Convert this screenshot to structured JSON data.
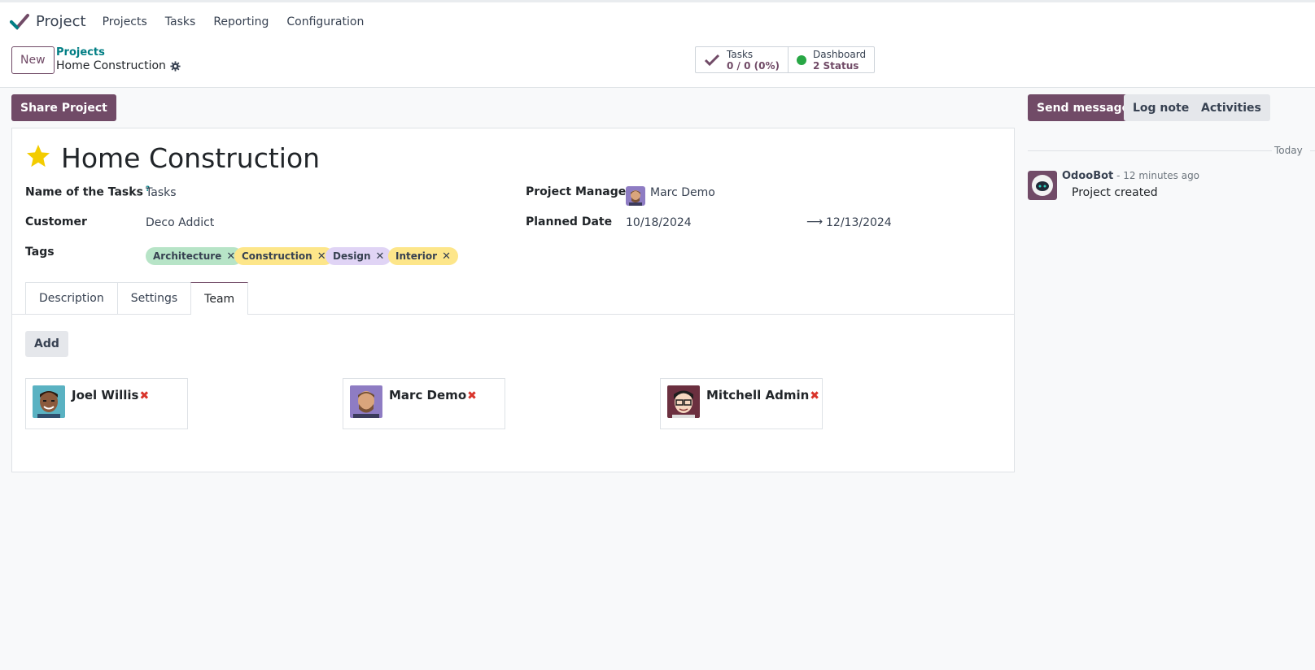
{
  "navbar": {
    "app_name": "Project",
    "menu": [
      "Projects",
      "Tasks",
      "Reporting",
      "Configuration"
    ]
  },
  "control": {
    "new_label": "New",
    "breadcrumb_parent": "Projects",
    "breadcrumb_current": "Home Construction",
    "stats": [
      {
        "label": "Tasks",
        "value": "0 / 0 (0%)"
      },
      {
        "label": "Dashboard",
        "value": "2 Status"
      }
    ]
  },
  "share_label": "Share Project",
  "form": {
    "title": "Home Construction",
    "fields": {
      "tasks_name_label": "Name of the Tasks",
      "tasks_name_help": "?",
      "tasks_name_value": "Tasks",
      "customer_label": "Customer",
      "customer_value": "Deco Addict",
      "tags_label": "Tags",
      "manager_label": "Project Manager",
      "manager_value": "Marc Demo",
      "planned_label": "Planned Date",
      "planned_start": "10/18/2024",
      "planned_end": "12/13/2024",
      "arrow": "⟶"
    },
    "tags": [
      {
        "label": "Architecture",
        "color": "#b7e4c7"
      },
      {
        "label": "Construction",
        "color": "#fde68a"
      },
      {
        "label": "Design",
        "color": "#e0d4f5"
      },
      {
        "label": "Interior",
        "color": "#fde68a"
      }
    ],
    "tabs": [
      "Description",
      "Settings",
      "Team"
    ],
    "active_tab": "Team",
    "add_label": "Add",
    "members": [
      {
        "name": "Joel Willis",
        "remove": "✖"
      },
      {
        "name": "Marc Demo",
        "remove": "✖"
      },
      {
        "name": "Mitchell Admin",
        "remove": "✖"
      }
    ]
  },
  "chatter": {
    "send_label": "Send message",
    "log_label": "Log note",
    "activities_label": "Activities",
    "today": "Today",
    "author": "OdooBot",
    "time": " - 12 minutes ago",
    "message": "Project created"
  },
  "colors": {
    "brand": "#714b67",
    "link": "#017e84",
    "remove": "#d9342b",
    "status_green": "#28a745"
  }
}
